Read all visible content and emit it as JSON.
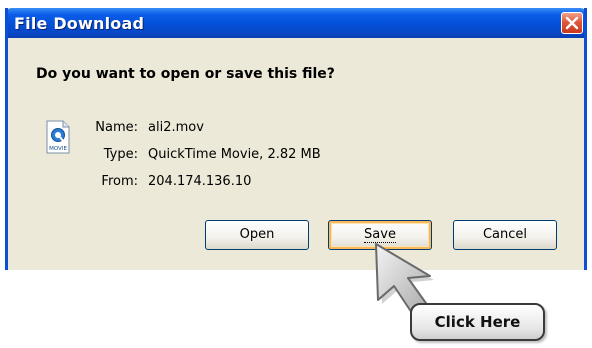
{
  "window": {
    "title": "File Download",
    "close_icon": "close-x-icon"
  },
  "question": "Do you want to open or save this file?",
  "file": {
    "icon": "quicktime-movie-file-icon",
    "icon_label": "MOVIE",
    "name_label": "Name:",
    "name_value": "ali2.mov",
    "type_label": "Type:",
    "type_value": "QuickTime Movie, 2.82 MB",
    "from_label": "From:",
    "from_value": "204.174.136.10"
  },
  "buttons": {
    "open": "Open",
    "save": "Save",
    "cancel": "Cancel"
  },
  "annotation": {
    "pointer_icon": "arrow-cursor-icon",
    "callout_text": "Click Here"
  },
  "colors": {
    "titlebar": "#0450D8",
    "dialog_bg": "#ECE9D8",
    "close_button": "#E1573A",
    "save_focus": "#F8B85A"
  }
}
